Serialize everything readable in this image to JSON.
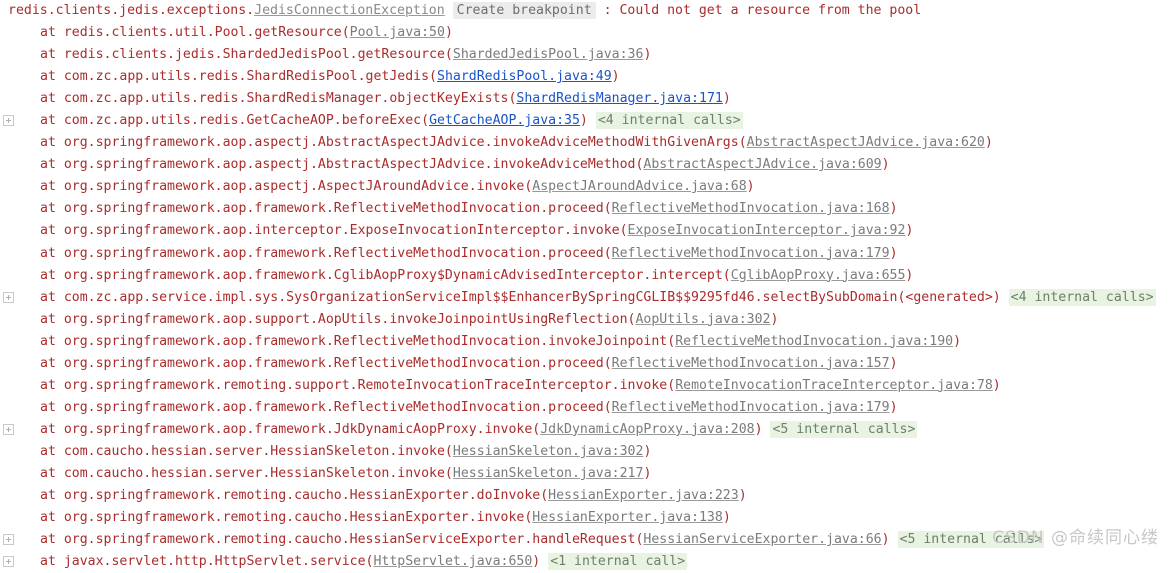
{
  "console": {
    "watermark": "CSDN @命续同心缕",
    "header": {
      "exception_package": "redis.clients.jedis.exceptions.",
      "exception_class": "JedisConnectionException",
      "breakpoint_label": "Create breakpoint",
      "separator": " : ",
      "message": "Could not get a resource from the pool"
    },
    "frames": [
      {
        "gutter": false,
        "at": "at ",
        "frame": "redis.clients.util.Pool.getResource(",
        "link": "Pool.java:50",
        "link_kind": "lib",
        "close": ")",
        "internal": ""
      },
      {
        "gutter": false,
        "at": "at ",
        "frame": "redis.clients.jedis.ShardedJedisPool.getResource(",
        "link": "ShardedJedisPool.java:36",
        "link_kind": "lib",
        "close": ")",
        "internal": ""
      },
      {
        "gutter": false,
        "at": "at ",
        "frame": "com.zc.app.utils.redis.ShardRedisPool.getJedis(",
        "link": "ShardRedisPool.java:49",
        "link_kind": "proj",
        "close": ")",
        "internal": ""
      },
      {
        "gutter": false,
        "at": "at ",
        "frame": "com.zc.app.utils.redis.ShardRedisManager.objectKeyExists(",
        "link": "ShardRedisManager.java:171",
        "link_kind": "proj",
        "close": ")",
        "internal": ""
      },
      {
        "gutter": true,
        "at": "at ",
        "frame": "com.zc.app.utils.redis.GetCacheAOP.beforeExec(",
        "link": "GetCacheAOP.java:35",
        "link_kind": "proj",
        "close": ")",
        "internal": "<4 internal calls>"
      },
      {
        "gutter": false,
        "at": "at ",
        "frame": "org.springframework.aop.aspectj.AbstractAspectJAdvice.invokeAdviceMethodWithGivenArgs(",
        "link": "AbstractAspectJAdvice.java:620",
        "link_kind": "lib",
        "close": ")",
        "internal": ""
      },
      {
        "gutter": false,
        "at": "at ",
        "frame": "org.springframework.aop.aspectj.AbstractAspectJAdvice.invokeAdviceMethod(",
        "link": "AbstractAspectJAdvice.java:609",
        "link_kind": "lib",
        "close": ")",
        "internal": ""
      },
      {
        "gutter": false,
        "at": "at ",
        "frame": "org.springframework.aop.aspectj.AspectJAroundAdvice.invoke(",
        "link": "AspectJAroundAdvice.java:68",
        "link_kind": "lib",
        "close": ")",
        "internal": ""
      },
      {
        "gutter": false,
        "at": "at ",
        "frame": "org.springframework.aop.framework.ReflectiveMethodInvocation.proceed(",
        "link": "ReflectiveMethodInvocation.java:168",
        "link_kind": "lib",
        "close": ")",
        "internal": ""
      },
      {
        "gutter": false,
        "at": "at ",
        "frame": "org.springframework.aop.interceptor.ExposeInvocationInterceptor.invoke(",
        "link": "ExposeInvocationInterceptor.java:92",
        "link_kind": "lib",
        "close": ")",
        "internal": ""
      },
      {
        "gutter": false,
        "at": "at ",
        "frame": "org.springframework.aop.framework.ReflectiveMethodInvocation.proceed(",
        "link": "ReflectiveMethodInvocation.java:179",
        "link_kind": "lib",
        "close": ")",
        "internal": ""
      },
      {
        "gutter": false,
        "at": "at ",
        "frame": "org.springframework.aop.framework.CglibAopProxy$DynamicAdvisedInterceptor.intercept(",
        "link": "CglibAopProxy.java:655",
        "link_kind": "lib",
        "close": ")",
        "internal": ""
      },
      {
        "gutter": true,
        "at": "at ",
        "frame": "com.zc.app.service.impl.sys.SysOrganizationServiceImpl$$EnhancerBySpringCGLIB$$9295fd46.selectBySubDomain(<generated>)",
        "link": "",
        "link_kind": "none",
        "close": "",
        "internal": "<4 internal calls>"
      },
      {
        "gutter": false,
        "at": "at ",
        "frame": "org.springframework.aop.support.AopUtils.invokeJoinpointUsingReflection(",
        "link": "AopUtils.java:302",
        "link_kind": "lib",
        "close": ")",
        "internal": ""
      },
      {
        "gutter": false,
        "at": "at ",
        "frame": "org.springframework.aop.framework.ReflectiveMethodInvocation.invokeJoinpoint(",
        "link": "ReflectiveMethodInvocation.java:190",
        "link_kind": "lib",
        "close": ")",
        "internal": ""
      },
      {
        "gutter": false,
        "at": "at ",
        "frame": "org.springframework.aop.framework.ReflectiveMethodInvocation.proceed(",
        "link": "ReflectiveMethodInvocation.java:157",
        "link_kind": "lib",
        "close": ")",
        "internal": ""
      },
      {
        "gutter": false,
        "at": "at ",
        "frame": "org.springframework.remoting.support.RemoteInvocationTraceInterceptor.invoke(",
        "link": "RemoteInvocationTraceInterceptor.java:78",
        "link_kind": "lib",
        "close": ")",
        "internal": ""
      },
      {
        "gutter": false,
        "at": "at ",
        "frame": "org.springframework.aop.framework.ReflectiveMethodInvocation.proceed(",
        "link": "ReflectiveMethodInvocation.java:179",
        "link_kind": "lib",
        "close": ")",
        "internal": ""
      },
      {
        "gutter": true,
        "at": "at ",
        "frame": "org.springframework.aop.framework.JdkDynamicAopProxy.invoke(",
        "link": "JdkDynamicAopProxy.java:208",
        "link_kind": "lib",
        "close": ")",
        "internal": "<5 internal calls>"
      },
      {
        "gutter": false,
        "at": "at ",
        "frame": "com.caucho.hessian.server.HessianSkeleton.invoke(",
        "link": "HessianSkeleton.java:302",
        "link_kind": "lib",
        "close": ")",
        "internal": ""
      },
      {
        "gutter": false,
        "at": "at ",
        "frame": "com.caucho.hessian.server.HessianSkeleton.invoke(",
        "link": "HessianSkeleton.java:217",
        "link_kind": "lib",
        "close": ")",
        "internal": ""
      },
      {
        "gutter": false,
        "at": "at ",
        "frame": "org.springframework.remoting.caucho.HessianExporter.doInvoke(",
        "link": "HessianExporter.java:223",
        "link_kind": "lib",
        "close": ")",
        "internal": ""
      },
      {
        "gutter": false,
        "at": "at ",
        "frame": "org.springframework.remoting.caucho.HessianExporter.invoke(",
        "link": "HessianExporter.java:138",
        "link_kind": "lib",
        "close": ")",
        "internal": ""
      },
      {
        "gutter": true,
        "at": "at ",
        "frame": "org.springframework.remoting.caucho.HessianServiceExporter.handleRequest(",
        "link": "HessianServiceExporter.java:66",
        "link_kind": "lib",
        "close": ")",
        "internal": "<5 internal calls>"
      },
      {
        "gutter": true,
        "at": "at ",
        "frame": "javax.servlet.http.HttpServlet.service(",
        "link": "HttpServlet.java:650",
        "link_kind": "lib",
        "close": ")",
        "internal": "<1 internal call>"
      }
    ]
  }
}
